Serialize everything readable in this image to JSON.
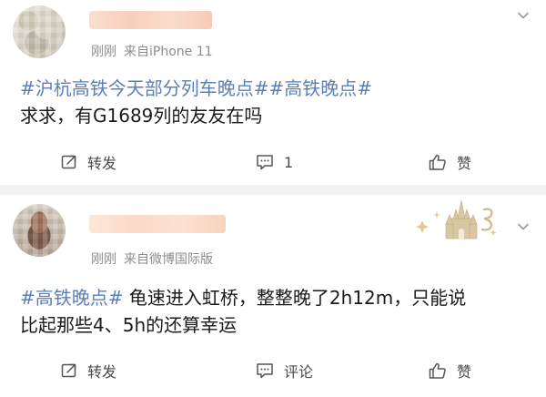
{
  "posts": [
    {
      "time": "刚刚",
      "source": "来自iPhone 11",
      "hashtags_line": "#沪杭高铁今天部分列车晚点##高铁晚点#",
      "text": "求求，有G1689列的友友在吗",
      "actions": {
        "repost_label": "转发",
        "comment_label": "1",
        "like_label": "赞"
      }
    },
    {
      "time": "刚刚",
      "source": "来自微博国际版",
      "hashtag": "#高铁晚点#",
      "text_line1": "龟速进入虹桥，整整晚了2h12m，只能说",
      "text_line2": "比起那些4、5h的还算幸运",
      "actions": {
        "repost_label": "转发",
        "comment_label": "评论",
        "like_label": "赞"
      }
    }
  ],
  "icons": {
    "repost": "repost-icon",
    "comment": "comment-icon",
    "like": "thumbs-up-icon",
    "more": "chevron-down-icon",
    "decoration": "castle-badge-icon"
  },
  "colors": {
    "hashtag": "#5b7fb8",
    "text": "#1a1a1a",
    "meta": "#8c8c8c",
    "background": "#f2f2f2",
    "card": "#ffffff"
  }
}
